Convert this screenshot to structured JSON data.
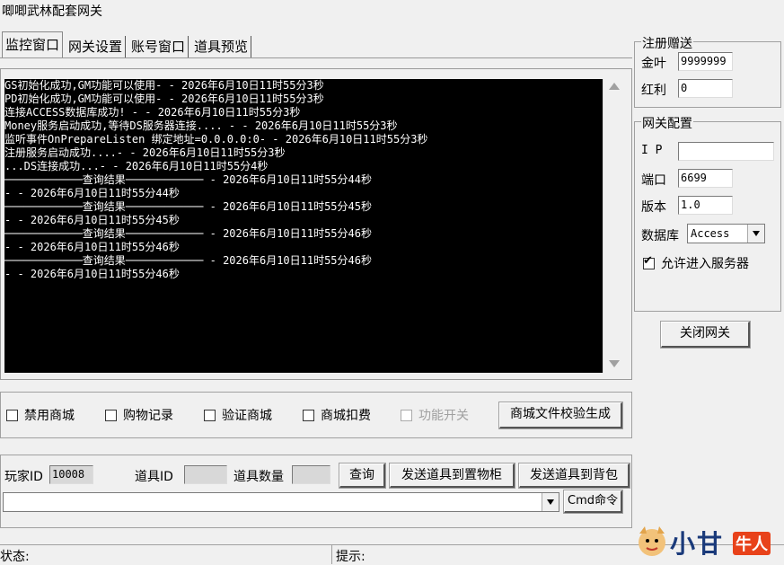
{
  "window_title": "唧唧武林配套网关",
  "tabs": [
    "监控窗口",
    "网关设置",
    "账号窗口",
    "道具预览"
  ],
  "console_lines": [
    "GS初始化成功,GM功能可以使用- - 2026年6月10日11时55分3秒",
    "PD初始化成功,GM功能可以使用- - 2026年6月10日11时55分3秒",
    "连接ACCESS数据库成功! - - 2026年6月10日11时55分3秒",
    "Money服务启动成功,等待DS服务器连接.... - - 2026年6月10日11时55分3秒",
    "监听事件OnPrepareListen 绑定地址=0.0.0.0:0- - 2026年6月10日11时55分3秒",
    "注册服务启动成功....- - 2026年6月10日11时55分3秒",
    "...DS连接成功...- - 2026年6月10日11时55分4秒",
    "────────────查询结果──────────── - 2026年6月10日11时55分44秒",
    "- - 2026年6月10日11时55分44秒",
    "────────────查询结果──────────── - 2026年6月10日11时55分45秒",
    "- - 2026年6月10日11时55分45秒",
    "────────────查询结果──────────── - 2026年6月10日11时55分46秒",
    "- - 2026年6月10日11时55分46秒",
    "────────────查询结果──────────── - 2026年6月10日11时55分46秒",
    "- - 2026年6月10日11时55分46秒"
  ],
  "mall_options": {
    "ban_mall": "禁用商城",
    "purchase_log": "购物记录",
    "verify_mall": "验证商城",
    "mall_deduct": "商城扣费",
    "feature_switch": "功能开关",
    "generate_btn": "商城文件校验生成"
  },
  "item_send": {
    "player_id_label": "玩家ID",
    "player_id_value": "10008",
    "item_id_label": "道具ID",
    "item_id_value": "",
    "item_qty_label": "道具数量",
    "item_qty_value": "",
    "query_btn": "查询",
    "send_to_storage_btn": "发送道具到置物柜",
    "send_to_bag_btn": "发送道具到背包",
    "cmd_value": "",
    "cmd_btn": "Cmd命令"
  },
  "register_gift": {
    "title": "注册赠送",
    "gold_label": "金叶",
    "gold_value": "9999999",
    "bonus_label": "红利",
    "bonus_value": "0"
  },
  "gateway_config": {
    "title": "网关配置",
    "ip_label": "I P",
    "ip_value": "",
    "port_label": "端口",
    "port_value": "6699",
    "version_label": "版本",
    "version_value": "1.0",
    "db_label": "数据库",
    "db_value": "Access",
    "allow_label": "允许进入服务器",
    "allow_checked": true
  },
  "close_gateway_btn": "关闭网关",
  "status_bar": {
    "status_label": "状态:",
    "hint_label": "提示:"
  },
  "watermark": {
    "text1": "小甘",
    "text2": "牛人"
  }
}
